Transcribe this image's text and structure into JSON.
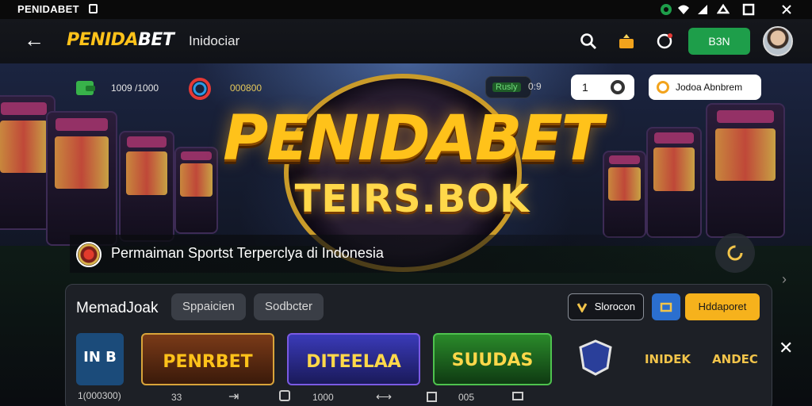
{
  "status_bar": {
    "app_name": "PENIDABET",
    "icons": [
      "record-icon",
      "wifi-icon",
      "signal-icon",
      "square-icon",
      "close-icon"
    ]
  },
  "app_bar": {
    "logo_prefix": "PENIDA",
    "logo_suffix": "BET",
    "region": "Inidociar",
    "action_button": "B3N",
    "icons": [
      "back-icon",
      "search-icon",
      "gift-icon",
      "headset-icon"
    ]
  },
  "hero": {
    "balance_left": "1009 /1000",
    "points": "000800",
    "mini_label": "Rusly",
    "mini_value": "0:9",
    "level_label": "1",
    "promo_button": "Jodoa Abnbrem",
    "title": "PENIDABET",
    "subtitle": "TEIRS.BOK",
    "tagline": "Permaiman Sportst Terperclya di Indonesia"
  },
  "panel": {
    "title": "MemadJoak",
    "tabs": [
      "Sppaicien",
      "Sodbcter"
    ],
    "outline_button": "Slorocon",
    "yellow_button": "Hddaporet",
    "cards": [
      {
        "label": "IN\nB",
        "bg": "#1b4b7a"
      },
      {
        "label": "PENRBET",
        "bg": "#5a2a14"
      },
      {
        "label": "DITEELAA",
        "bg": "#2b2a7a"
      },
      {
        "label": "SUUDAS",
        "bg": "#1e5a22"
      },
      {
        "label": "",
        "bg": "#2a2d48"
      },
      {
        "label": "INIDEK",
        "bg": "#3a2a26"
      },
      {
        "label": "ANDEC",
        "bg": "#3a2a26"
      }
    ],
    "bottom_items": [
      "1(000300)",
      "33",
      "1000",
      "005"
    ]
  },
  "colors": {
    "gold": "#ffc21a",
    "green": "#1e9e4a",
    "blue": "#2b6fcf",
    "yellow": "#f6b21c",
    "panel": "#1e2128"
  }
}
